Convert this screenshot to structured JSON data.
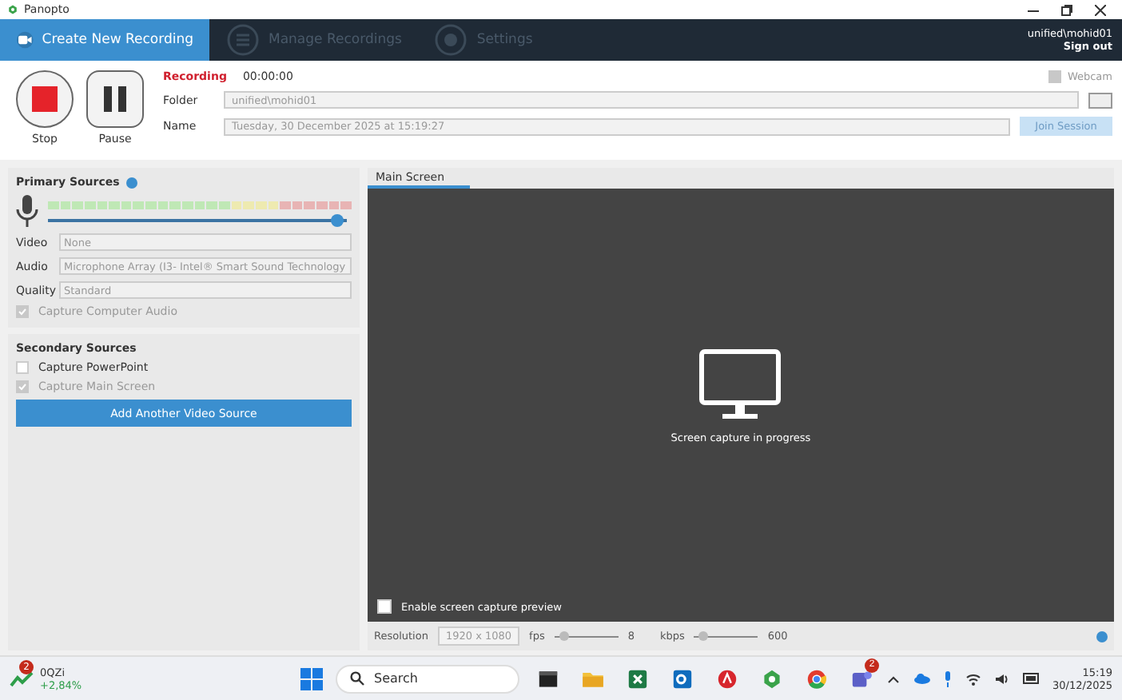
{
  "window": {
    "title": "Panopto"
  },
  "nav": {
    "tabs": [
      {
        "label": "Create New Recording",
        "selected": true
      },
      {
        "label": "Manage Recordings",
        "selected": false
      },
      {
        "label": "Settings",
        "selected": false
      }
    ],
    "user": "unified\\mohid01",
    "sign_out": "Sign out"
  },
  "controls": {
    "stop": "Stop",
    "pause": "Pause",
    "status": "Recording",
    "time": "00:00:00",
    "webcam": {
      "label": "Webcam",
      "checked": false,
      "disabled": true
    },
    "folder_label": "Folder",
    "folder": "unified\\mohid01",
    "name_label": "Name",
    "name": "Tuesday, 30 December 2025 at 15:19:27",
    "join_button": "Join Session"
  },
  "primary": {
    "title": "Primary Sources",
    "gain": {
      "level": 0.97
    },
    "fields": [
      {
        "label": "Video",
        "value": "None"
      },
      {
        "label": "Audio",
        "value": "Microphone Array (I3- Intel® Smart Sound Technology"
      },
      {
        "label": "Quality",
        "value": "Standard"
      }
    ],
    "computer_audio": {
      "label": "Capture Computer Audio",
      "checked": true,
      "disabled": true
    }
  },
  "secondary": {
    "title": "Secondary Sources",
    "options": [
      {
        "label": "Capture PowerPoint",
        "checked": false,
        "disabled": false
      },
      {
        "label": "Capture Main Screen",
        "checked": true,
        "disabled": true
      }
    ],
    "add_button": "Add Another Video Source"
  },
  "preview": {
    "tab": "Main Screen",
    "message": "Screen capture in progress",
    "enable_preview": {
      "label": "Enable screen capture preview",
      "checked": false
    },
    "resolution_label": "Resolution",
    "resolution": "1920 x 1080",
    "fps_label": "fps",
    "fps": "8",
    "fps_slider": {
      "level": 0.15
    },
    "kbps_label": "kbps",
    "kbps": "600",
    "kbps_slider": {
      "level": 0.15
    }
  },
  "taskbar": {
    "widget": {
      "badge": "2",
      "title": "0QZi",
      "change": "+2,84%"
    },
    "search": {
      "placeholder": "Search"
    },
    "apps": [
      {
        "kind": "terminal"
      },
      {
        "kind": "folder"
      },
      {
        "kind": "sheet"
      },
      {
        "kind": "mail"
      },
      {
        "kind": "reader"
      },
      {
        "kind": "recorder"
      },
      {
        "kind": "browser"
      },
      {
        "kind": "chat",
        "badge": "2"
      }
    ],
    "time": "15:19",
    "date": "30/12/2025"
  }
}
